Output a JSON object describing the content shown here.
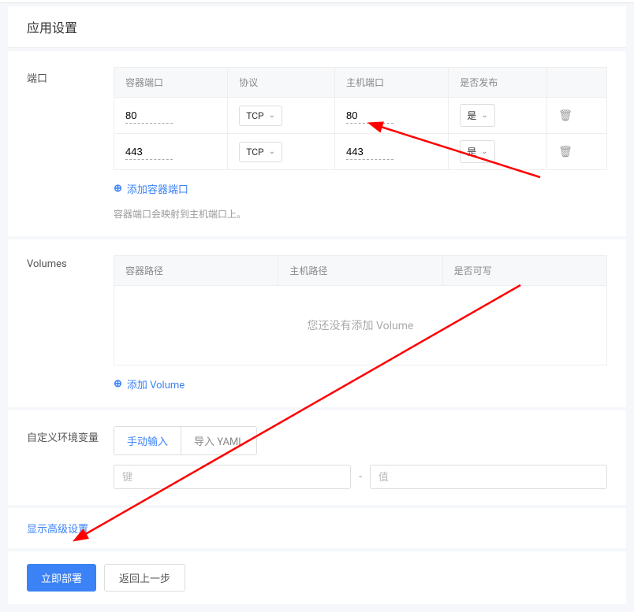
{
  "section_title": "应用设置",
  "ports": {
    "label": "端口",
    "headers": {
      "container": "容器端口",
      "protocol": "协议",
      "host": "主机端口",
      "publish": "是否发布"
    },
    "rows": [
      {
        "container_port": "80",
        "protocol": "TCP",
        "host_port": "80",
        "publish": "是"
      },
      {
        "container_port": "443",
        "protocol": "TCP",
        "host_port": "443",
        "publish": "是"
      }
    ],
    "add_label": "添加容器端口",
    "hint": "容器端口会映射到主机端口上。"
  },
  "volumes": {
    "label": "Volumes",
    "headers": {
      "container": "容器路径",
      "host": "主机路径",
      "writable": "是否可写"
    },
    "empty_text": "您还没有添加 Volume",
    "add_label": "添加 Volume"
  },
  "env": {
    "label": "自定义环境变量",
    "tabs": {
      "manual": "手动输入",
      "yaml": "导入 YAML"
    },
    "key_placeholder": "键",
    "value_placeholder": "值"
  },
  "advanced_label": "显示高级设置",
  "footer": {
    "deploy": "立即部署",
    "back": "返回上一步"
  }
}
